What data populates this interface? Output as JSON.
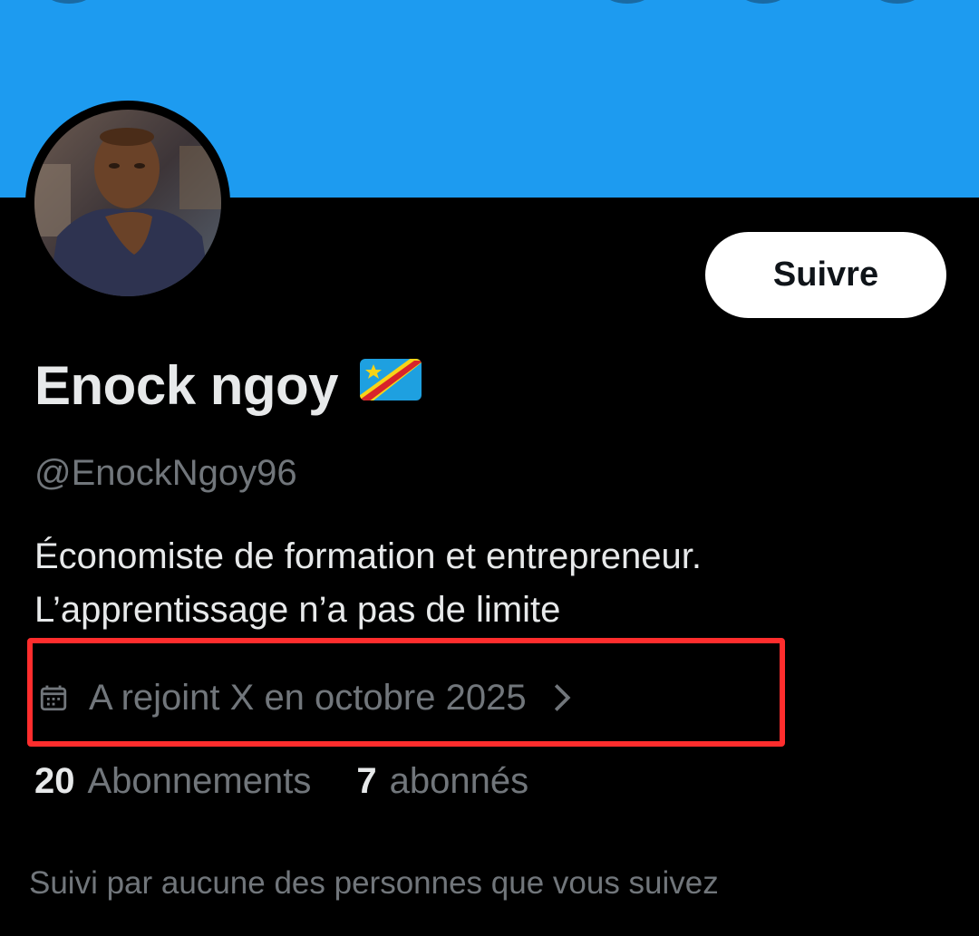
{
  "profile": {
    "avatar_icon": "profile-photo-avatar",
    "follow_label": "Suivre",
    "display_name": "Enock ngoy",
    "flag_icon": "dr-congo-flag-icon",
    "handle": "@EnockNgoy96",
    "bio_line1": "Économiste de formation et entrepreneur.",
    "bio_line2": "L’apprentissage n’a pas de limite",
    "calendar_icon": "calendar-icon",
    "joined_text": "A rejoint X en octobre 2025",
    "chevron_icon": "chevron-right-icon",
    "following_count": "20",
    "following_label": "Abonnements",
    "followers_count": "7",
    "followers_label": "abonnés",
    "followed_by_text": "Suivi par aucune des personnes que vous suivez"
  },
  "colors": {
    "banner": "#1d9bf0",
    "background": "#000000",
    "primary_text": "#e7e9ea",
    "secondary_text": "#71767b",
    "highlight_box": "#ff2d2d"
  }
}
